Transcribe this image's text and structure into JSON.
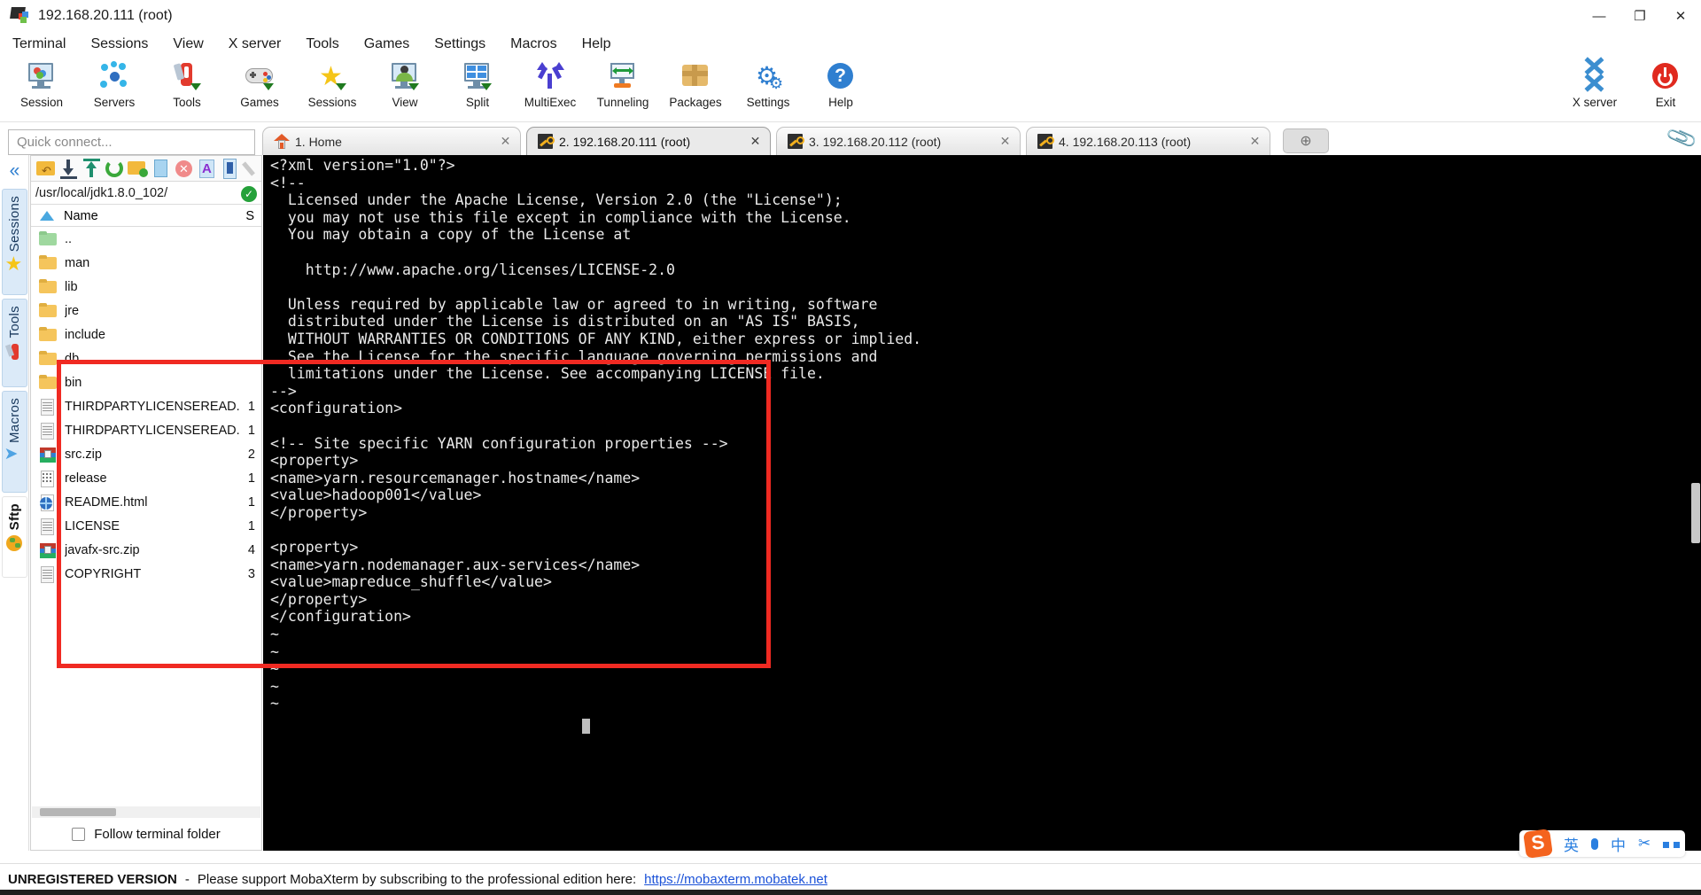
{
  "window": {
    "title": "192.168.20.111 (root)",
    "icon": "mobaxterm-logo-icon",
    "minimize": "—",
    "maximize": "❐",
    "close": "✕"
  },
  "menubar": {
    "items": [
      {
        "label": "Terminal"
      },
      {
        "label": "Sessions"
      },
      {
        "label": "View"
      },
      {
        "label": "X server"
      },
      {
        "label": "Tools"
      },
      {
        "label": "Games"
      },
      {
        "label": "Settings"
      },
      {
        "label": "Macros"
      },
      {
        "label": "Help"
      }
    ]
  },
  "toolbar": {
    "items": [
      {
        "label": "Session",
        "icon": "session-monitor-icon"
      },
      {
        "label": "Servers",
        "icon": "servers-network-icon"
      },
      {
        "label": "Tools",
        "icon": "swiss-knife-icon"
      },
      {
        "label": "Games",
        "icon": "gamepad-icon"
      },
      {
        "label": "Sessions",
        "icon": "star-icon"
      },
      {
        "label": "View",
        "icon": "user-monitor-icon"
      },
      {
        "label": "Split",
        "icon": "split-grid-icon"
      },
      {
        "label": "MultiExec",
        "icon": "multiexec-fork-icon"
      },
      {
        "label": "Tunneling",
        "icon": "tunneling-arrows-icon"
      },
      {
        "label": "Packages",
        "icon": "packages-box-icon"
      },
      {
        "label": "Settings",
        "icon": "gear-icon"
      },
      {
        "label": "Help",
        "icon": "help-question-icon"
      }
    ],
    "right_items": [
      {
        "label": "X server",
        "icon": "x-server-icon"
      },
      {
        "label": "Exit",
        "icon": "power-exit-icon"
      }
    ]
  },
  "quick_connect": {
    "placeholder": "Quick connect..."
  },
  "tabs": {
    "items": [
      {
        "label": "1. Home",
        "icon": "home-icon",
        "active": false,
        "closable": true
      },
      {
        "label": "2. 192.168.20.111 (root)",
        "icon": "key-icon",
        "active": true,
        "closable": true
      },
      {
        "label": "3. 192.168.20.112 (root)",
        "icon": "key-icon",
        "active": false,
        "closable": true
      },
      {
        "label": "4. 192.168.20.113 (root)",
        "icon": "key-icon",
        "active": false,
        "closable": true
      }
    ],
    "new_tab_label": "⊕",
    "clip_icon": "paperclip-icon"
  },
  "sidebar": {
    "collapse_icon": "chevron-double-left-icon",
    "tabs": [
      {
        "label": "Sessions",
        "icon": "star-icon"
      },
      {
        "label": "Tools",
        "icon": "swiss-knife-icon"
      },
      {
        "label": "Macros",
        "icon": "paper-plane-icon"
      },
      {
        "label": "Sftp",
        "icon": "globe-icon"
      }
    ]
  },
  "sftp": {
    "toolbar_icons": [
      "go-up-folder-icon",
      "download-icon",
      "upload-icon",
      "refresh-icon",
      "new-folder-icon",
      "new-file-icon",
      "delete-icon",
      "text-edit-icon",
      "terminal-icon",
      "edit-pencil-icon"
    ],
    "path": "/usr/local/jdk1.8.0_102/",
    "path_status_icon": "check-circle-icon",
    "columns": {
      "name": "Name",
      "size": "S"
    },
    "sort_icon": "sort-ascending-icon",
    "files": [
      {
        "name": "..",
        "size": "",
        "icon": "folder-up-icon"
      },
      {
        "name": "man",
        "size": "",
        "icon": "folder-icon"
      },
      {
        "name": "lib",
        "size": "",
        "icon": "folder-icon"
      },
      {
        "name": "jre",
        "size": "",
        "icon": "folder-icon"
      },
      {
        "name": "include",
        "size": "",
        "icon": "folder-icon"
      },
      {
        "name": "db",
        "size": "",
        "icon": "folder-icon"
      },
      {
        "name": "bin",
        "size": "",
        "icon": "folder-icon"
      },
      {
        "name": "THIRDPARTYLICENSEREAD...",
        "size": "1",
        "icon": "text-file-icon"
      },
      {
        "name": "THIRDPARTYLICENSEREAD...",
        "size": "1",
        "icon": "text-file-icon"
      },
      {
        "name": "src.zip",
        "size": "2",
        "icon": "zip-archive-icon"
      },
      {
        "name": "release",
        "size": "1",
        "icon": "data-file-icon"
      },
      {
        "name": "README.html",
        "size": "1",
        "icon": "html-globe-icon"
      },
      {
        "name": "LICENSE",
        "size": "1",
        "icon": "text-file-icon"
      },
      {
        "name": "javafx-src.zip",
        "size": "4",
        "icon": "zip-archive-icon"
      },
      {
        "name": "COPYRIGHT",
        "size": "3",
        "icon": "text-file-icon"
      }
    ],
    "follow_terminal_folder": "Follow terminal folder"
  },
  "terminal": {
    "content": "<?xml version=\"1.0\"?>\n<!--\n  Licensed under the Apache License, Version 2.0 (the \"License\");\n  you may not use this file except in compliance with the License.\n  You may obtain a copy of the License at\n\n    http://www.apache.org/licenses/LICENSE-2.0\n\n  Unless required by applicable law or agreed to in writing, software\n  distributed under the License is distributed on an \"AS IS\" BASIS,\n  WITHOUT WARRANTIES OR CONDITIONS OF ANY KIND, either express or implied.\n  See the License for the specific language governing permissions and\n  limitations under the License. See accompanying LICENSE file.\n-->\n<configuration>\n\n<!-- Site specific YARN configuration properties -->\n<property>\n<name>yarn.resourcemanager.hostname</name>\n<value>hadoop001</value>\n</property>\n\n<property>\n<name>yarn.nodemanager.aux-services</name>\n<value>mapreduce_shuffle</value>\n</property>\n</configuration>\n~\n~\n~\n~\n~",
    "background": "#000000",
    "foreground": "#e9e9e9"
  },
  "annotation": {
    "shape": "rectangle",
    "color": "#f02a22"
  },
  "statusbar": {
    "unregistered": "UNREGISTERED VERSION",
    "separator": "-",
    "message": "Please support MobaXterm by subscribing to the professional edition here:",
    "link": "https://mobaxterm.mobatek.net"
  },
  "ime": {
    "logo": "S",
    "items": [
      {
        "icon": "chinese-english-toggle-icon",
        "label": "英"
      },
      {
        "icon": "microphone-icon",
        "label": "🎤"
      },
      {
        "icon": "translate-icon",
        "label": "中"
      },
      {
        "icon": "scissors-icon",
        "label": "✂"
      },
      {
        "icon": "apps-grid-icon",
        "label": "▦"
      }
    ]
  },
  "colors": {
    "accent_blue": "#2f7fd0",
    "annotation_red": "#f02a22",
    "terminal_bg": "#000000",
    "link_blue": "#1b52d8"
  }
}
